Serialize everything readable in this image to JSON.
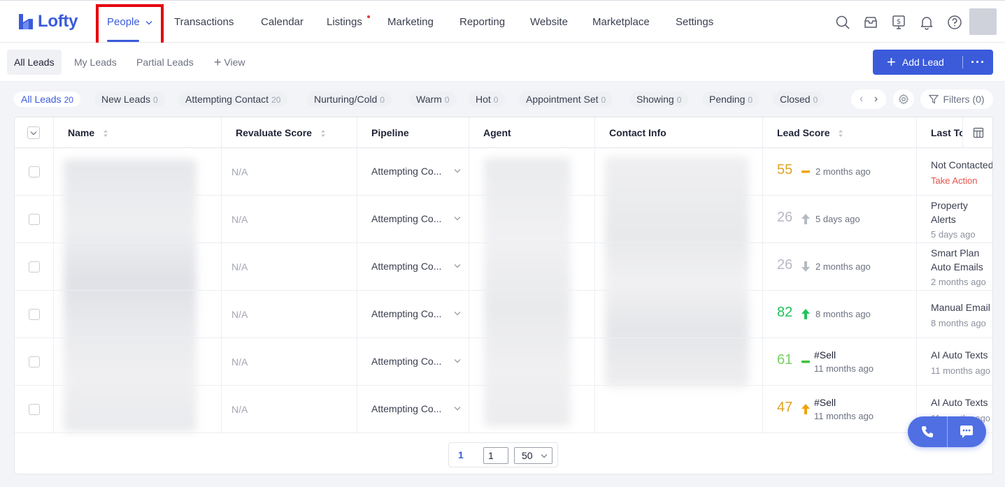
{
  "app": {
    "logo_text": "Lofty",
    "brand_color": "#3b5bdb"
  },
  "nav": {
    "people": "People",
    "transactions": "Transactions",
    "calendar": "Calendar",
    "listings": "Listings",
    "marketing": "Marketing",
    "reporting": "Reporting",
    "website": "Website",
    "marketplace": "Marketplace",
    "settings": "Settings"
  },
  "subnav": {
    "all_leads": "All Leads",
    "my_leads": "My Leads",
    "partial_leads": "Partial Leads",
    "view": "View",
    "add_lead": "Add Lead"
  },
  "chips": [
    {
      "label": "All Leads",
      "count": "20"
    },
    {
      "label": "New Leads",
      "count": "0"
    },
    {
      "label": "Attempting Contact",
      "count": "20"
    },
    {
      "label": "Nurturing/Cold",
      "count": "0"
    },
    {
      "label": "Warm",
      "count": "0"
    },
    {
      "label": "Hot",
      "count": "0"
    },
    {
      "label": "Appointment Set",
      "count": "0"
    },
    {
      "label": "Showing",
      "count": "0"
    },
    {
      "label": "Pending",
      "count": "0"
    },
    {
      "label": "Closed",
      "count": "0"
    }
  ],
  "filters_label": "Filters (0)",
  "table": {
    "headers": {
      "name": "Name",
      "revaluate": "Revaluate Score",
      "pipeline": "Pipeline",
      "agent": "Agent",
      "contact": "Contact Info",
      "lead_score": "Lead Score",
      "last_touch": "Last To"
    },
    "rows": [
      {
        "revaluate": "N/A",
        "pipeline": "Attempting Co...",
        "score": "55",
        "score_color": "#e0a326",
        "trend": "flat",
        "trend_color": "#f0a30a",
        "tag": "",
        "time": "2 months ago",
        "last_lines": [
          "Not Contacted"
        ],
        "last_sub": "Take Action"
      },
      {
        "revaluate": "N/A",
        "pipeline": "Attempting Co...",
        "score": "26",
        "score_color": "#b6bac3",
        "trend": "up",
        "trend_color": "#b6bac3",
        "tag": "",
        "time": "5 days ago",
        "last_lines": [
          "Property",
          "Alerts"
        ],
        "last_sub": "5 days ago"
      },
      {
        "revaluate": "N/A",
        "pipeline": "Attempting Co...",
        "score": "26",
        "score_color": "#b6bac3",
        "trend": "down",
        "trend_color": "#b6bac3",
        "tag": "",
        "time": "2 months ago",
        "last_lines": [
          "Smart Plan",
          "Auto Emails"
        ],
        "last_sub": "2 months ago"
      },
      {
        "revaluate": "N/A",
        "pipeline": "Attempting Co...",
        "score": "82",
        "score_color": "#20c35a",
        "trend": "up",
        "trend_color": "#20c35a",
        "tag": "",
        "time": "8 months ago",
        "last_lines": [
          "Manual Email"
        ],
        "last_sub": "8 months ago"
      },
      {
        "revaluate": "N/A",
        "pipeline": "Attempting Co...",
        "score": "61",
        "score_color": "#79cf63",
        "trend": "flat",
        "trend_color": "#3cc23c",
        "tag": "#Sell",
        "time": "11 months ago",
        "last_lines": [
          "AI Auto Texts"
        ],
        "last_sub": "11 months ago"
      },
      {
        "revaluate": "N/A",
        "pipeline": "Attempting Co...",
        "score": "47",
        "score_color": "#e0a326",
        "trend": "up",
        "trend_color": "#f0a30a",
        "tag": "#Sell",
        "time": "11 months ago",
        "last_lines": [
          "AI Auto Texts"
        ],
        "last_sub": "11 months ago"
      }
    ]
  },
  "pagination": {
    "current": "1",
    "page_input": "1",
    "page_size": "50"
  }
}
